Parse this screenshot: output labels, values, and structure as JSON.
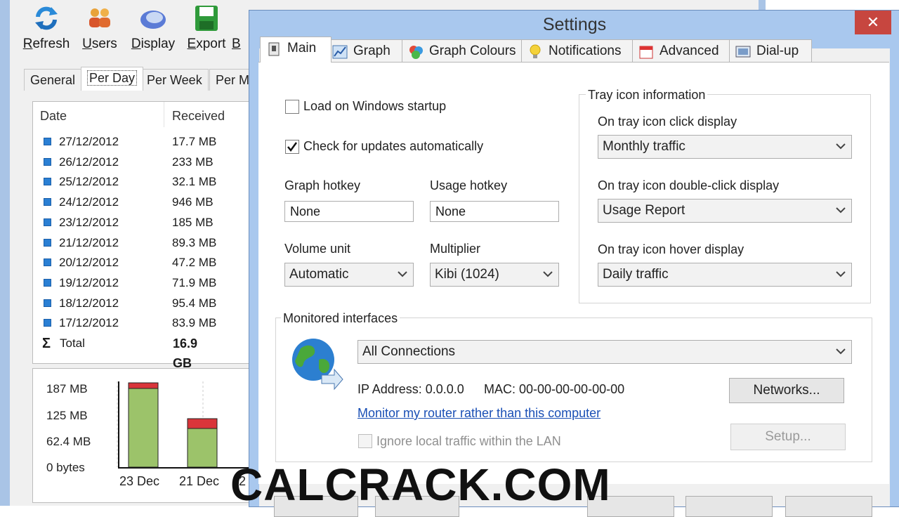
{
  "main_window": {
    "toolbar": [
      {
        "key": "refresh",
        "label_u": "R",
        "label_rest": "efresh",
        "icon": "refresh-icon"
      },
      {
        "key": "users",
        "label_u": "U",
        "label_rest": "sers",
        "icon": "users-icon"
      },
      {
        "key": "display",
        "label_u": "D",
        "label_rest": "isplay",
        "icon": "display-icon"
      },
      {
        "key": "export",
        "label_u": "E",
        "label_rest": "xport",
        "icon": "export-icon"
      },
      {
        "key": "b",
        "label_u": "B",
        "label_rest": "",
        "icon": "backup-icon"
      }
    ],
    "tabs": [
      "General",
      "Per Day",
      "Per Week",
      "Per M"
    ],
    "active_tab": "Per Day",
    "table": {
      "headers": [
        "Date",
        "Received"
      ],
      "rows": [
        {
          "date": "27/12/2012",
          "received": "17.7 MB"
        },
        {
          "date": "26/12/2012",
          "received": "233 MB"
        },
        {
          "date": "25/12/2012",
          "received": "32.1 MB"
        },
        {
          "date": "24/12/2012",
          "received": "946 MB"
        },
        {
          "date": "23/12/2012",
          "received": "185 MB"
        },
        {
          "date": "21/12/2012",
          "received": "89.3 MB"
        },
        {
          "date": "20/12/2012",
          "received": "47.2 MB"
        },
        {
          "date": "19/12/2012",
          "received": "71.9 MB"
        },
        {
          "date": "18/12/2012",
          "received": "95.4 MB"
        },
        {
          "date": "17/12/2012",
          "received": "83.9 MB"
        }
      ],
      "total_symbol": "Σ",
      "total_label": "Total",
      "total_value": "16.9 GB"
    },
    "graph": {
      "y_labels": [
        "187 MB",
        "125 MB",
        "62.4 MB",
        "0 bytes"
      ],
      "x_labels": [
        "23 Dec",
        "21 Dec",
        "2"
      ],
      "bar_colors": {
        "received": "#9cc36a",
        "sent": "#d9353a"
      }
    }
  },
  "settings": {
    "title": "Settings",
    "close_symbol": "✕",
    "tabs": [
      {
        "label": "Main",
        "icon": "main-tab-icon"
      },
      {
        "label": "Graph",
        "icon": "graph-tab-icon"
      },
      {
        "label": "Graph Colours",
        "icon": "colours-tab-icon"
      },
      {
        "label": "Notifications",
        "icon": "bulb-icon"
      },
      {
        "label": "Advanced",
        "icon": "calendar-icon"
      },
      {
        "label": "Dial-up",
        "icon": "dialup-icon"
      }
    ],
    "active_tab": "Main",
    "load_on_startup": {
      "label": "Load on Windows startup",
      "checked": false
    },
    "check_updates": {
      "label": "Check for updates automatically",
      "checked": true
    },
    "graph_hotkey": {
      "label": "Graph hotkey",
      "value": "None"
    },
    "usage_hotkey": {
      "label": "Usage hotkey",
      "value": "None"
    },
    "volume_unit": {
      "label": "Volume unit",
      "value": "Automatic"
    },
    "multiplier": {
      "label": "Multiplier",
      "value": "Kibi (1024)"
    },
    "tray": {
      "group_title": "Tray icon information",
      "click_label": "On tray icon click display",
      "click_value": "Monthly traffic",
      "dblclick_label": "On tray icon double-click display",
      "dblclick_value": "Usage Report",
      "hover_label": "On tray icon hover display",
      "hover_value": "Daily traffic"
    },
    "interfaces": {
      "group_title": "Monitored interfaces",
      "selected": "All Connections",
      "ip_text": "IP Address: 0.0.0.0",
      "mac_text": "MAC: 00-00-00-00-00-00",
      "networks_button": "Networks...",
      "router_link": "Monitor my router rather than this computer",
      "setup_button": "Setup...",
      "ignore_local": {
        "label": "Ignore local traffic within the LAN",
        "checked": false,
        "enabled": false
      }
    }
  },
  "watermark": "CALCRACK.COM"
}
